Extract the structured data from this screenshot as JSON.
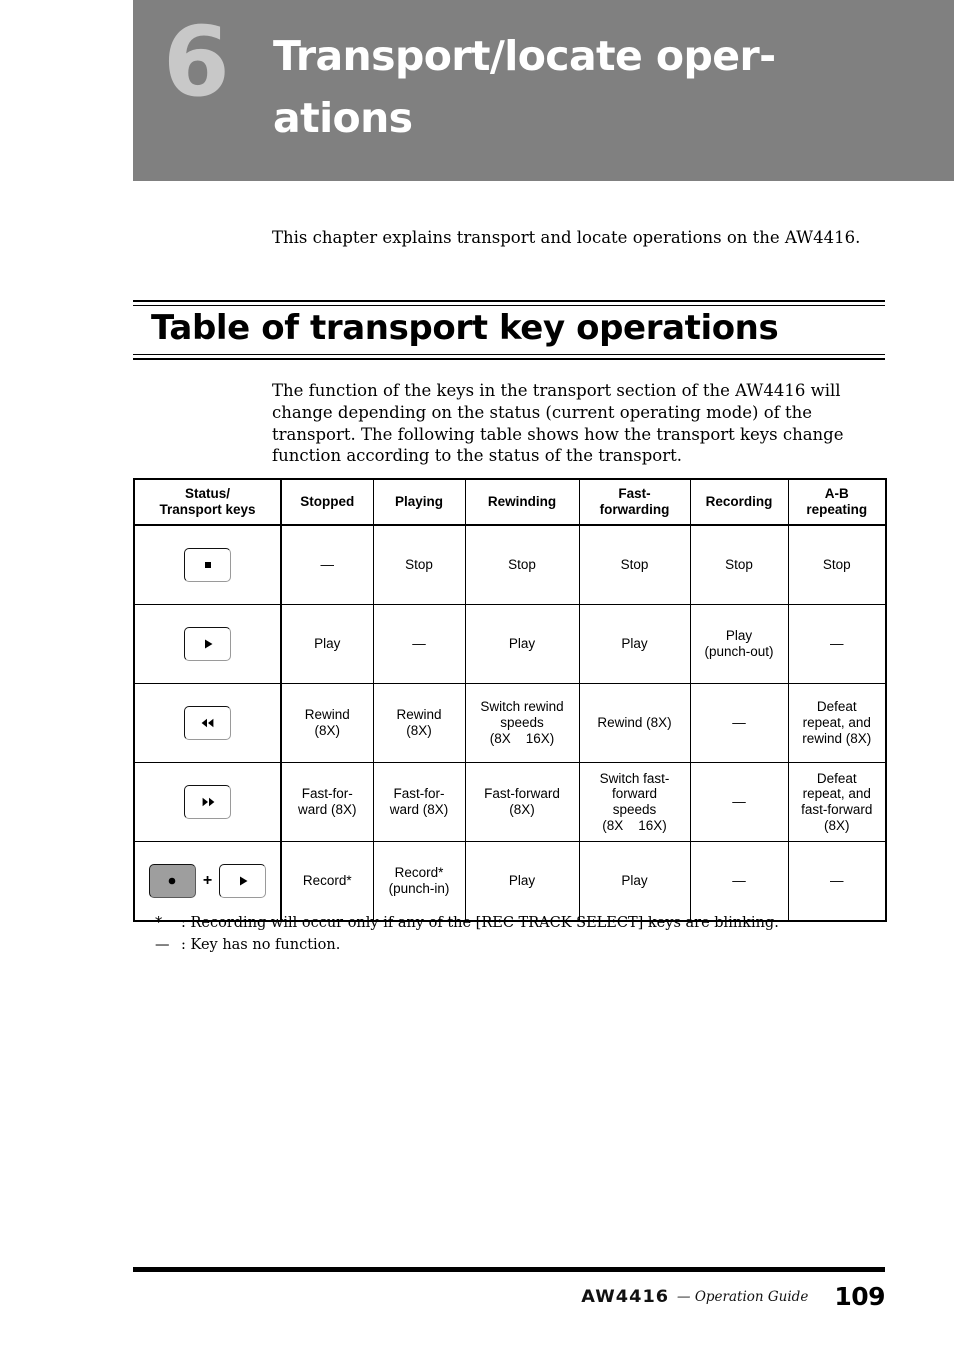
{
  "chapter": {
    "number": "6",
    "title": "Transport/locate oper-ations",
    "intro": "This chapter explains transport and locate operations on the AW4416."
  },
  "section": {
    "title": "Table of transport key operations",
    "body": "The function of the keys in the transport section of the AW4416 will change depending on the status (current operating mode) of the transport. The following table shows how the transport keys change function according to the status of the transport."
  },
  "table": {
    "headers": [
      "Status/ Transport keys",
      "Stopped",
      "Playing",
      "Rewinding",
      "Fast- forwarding",
      "Recording",
      "A-B repeating"
    ],
    "header_lines": [
      [
        "Status/",
        "Transport keys"
      ],
      [
        "Stopped"
      ],
      [
        "Playing"
      ],
      [
        "Rewinding"
      ],
      [
        "Fast-",
        "forwarding"
      ],
      [
        "Recording"
      ],
      [
        "A-B",
        "repeating"
      ]
    ],
    "rows": [
      {
        "key_name": "stop-key",
        "keys": [
          {
            "glyph": "stop-square-icon",
            "filled": false
          }
        ],
        "cells": [
          "—",
          "Stop",
          "Stop",
          "Stop",
          "Stop",
          "Stop"
        ]
      },
      {
        "key_name": "play-key",
        "keys": [
          {
            "glyph": "play-triangle-icon",
            "filled": false
          }
        ],
        "cells": [
          "Play",
          "—",
          "Play",
          "Play",
          "Play\n(punch-out)",
          "—"
        ]
      },
      {
        "key_name": "rewind-key",
        "keys": [
          {
            "glyph": "rewind-double-triangle-icon",
            "filled": false
          }
        ],
        "cells": [
          "Rewind\n(8X)",
          "Rewind\n(8X)",
          "Switch rewind\nspeeds\n(8X    16X)",
          "Rewind (8X)",
          "—",
          "Defeat\nrepeat, and\nrewind (8X)"
        ]
      },
      {
        "key_name": "fast-forward-key",
        "keys": [
          {
            "glyph": "fast-forward-double-triangle-icon",
            "filled": false
          }
        ],
        "cells": [
          "Fast-for-\nward (8X)",
          "Fast-for-\nward (8X)",
          "Fast-forward\n(8X)",
          "Switch fast-\nforward\nspeeds\n(8X    16X)",
          "—",
          "Defeat\nrepeat, and\nfast-forward\n(8X)"
        ]
      },
      {
        "key_name": "record-plus-play-keys",
        "keys": [
          {
            "glyph": "record-circle-icon",
            "filled": true
          },
          {
            "glyph": "play-triangle-icon",
            "filled": false
          }
        ],
        "plus": "+",
        "cells": [
          "Record*",
          "Record*\n(punch-in)",
          "Play",
          "Play",
          "—",
          "—"
        ]
      }
    ]
  },
  "footnotes": [
    {
      "mark": "*",
      "text": ": Recording will occur only if any of the [REC TRACK SELECT] keys are blinking."
    },
    {
      "mark": "—",
      "text": ": Key has no function."
    }
  ],
  "footer": {
    "brand": "AW4416",
    "guide": "— Operation Guide",
    "page_number": "109"
  },
  "colors": {
    "banner_gray": "#808080",
    "chapter_number_gray": "#c8c8c8",
    "key_fill_gray": "#9e9e9e"
  }
}
